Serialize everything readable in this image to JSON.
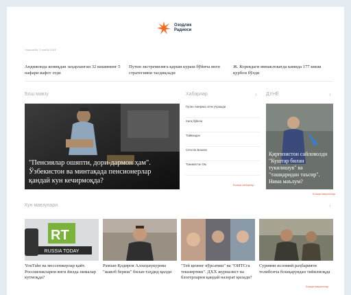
{
  "header": {
    "logo_line1": "Озодлик",
    "logo_line2": "Радиоси",
    "date": "Чоршанба, 3 ноябр 2021"
  },
  "top_news": [
    "Андижонда кониқдан заҳарланган 32 кишининг 5 нафари вафот этди",
    "Путин экстремизмга қарши кураш бўйича янги стратегияни тасдиқлади",
    "Ж. Кореядаги ямнаклокатда камида 177 киши қурбон бўлди"
  ],
  "main_section": {
    "title": "Бош мавзу",
    "hero_title": "\"Пенсиялар ошяпти, дори-дармон ҳам\". Ўзбекистон ва минтақада пенсионерлар қандай кун кечирмоқда?"
  },
  "news_section": {
    "title": "Хабарлар",
    "items": [
      "Путин Америка элчи учрашди",
      "Халқ бўйича",
      "Тайвандан",
      "Сочи ва Бишкек",
      "Тожикистон Ом"
    ],
    "more": "Бошқа хабарлар"
  },
  "world_section": {
    "title": "ДУНЁ",
    "hero_title": "Қирғизистон сайловолди \"Куштар билан тукиляшув\" ва \"ташқаридан таъсир\". Нима маълум?",
    "more": "Бошқа мақолалар"
  },
  "day_section": {
    "title": "Кун мавзулари",
    "cards": [
      {
        "caption": "YouTube ва мессенжерлар қайт. Россияликларни янги йилда нималар кутмоқда?",
        "thumb_text": "RUSSIA TODAY"
      },
      {
        "caption": "Рамзан Қодиров Аллаҳшукурова \"жавоб бериш\" билан таҳдид қилди"
      },
      {
        "caption": "\"Тей қизинг кўрсатиш\" ва \"ОИТСга текширтиш\". ДХХ журналист ва блогерларни қандай назорат қилади?"
      },
      {
        "caption": "Сурияни исломий раҳбарияти толибонча бошқарувдан тийилмоқда"
      }
    ],
    "more": "Бошқа мақолалар"
  },
  "colors": {
    "accent": "#e05a3a",
    "logo_orange": "#f26b21",
    "brand_text": "#1b2b48"
  }
}
